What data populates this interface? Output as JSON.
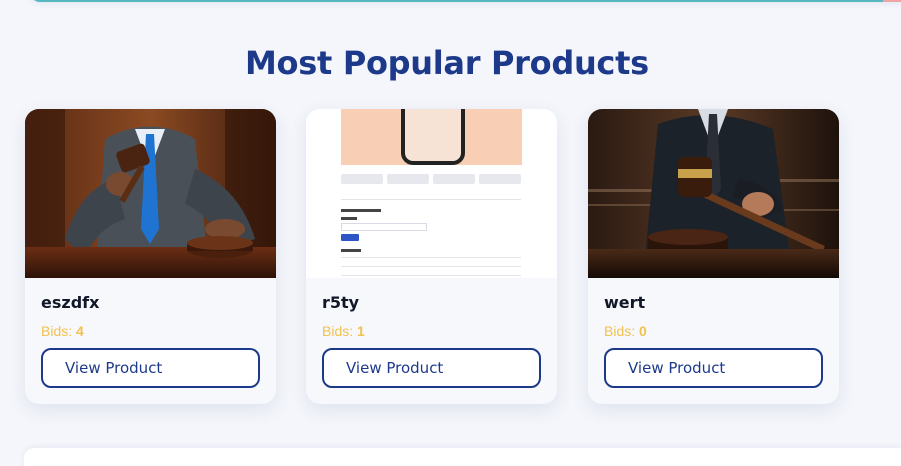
{
  "section": {
    "title": "Most Popular Products"
  },
  "products": [
    {
      "name": "eszdfx",
      "bids_label": "Bids:",
      "bids_count": "4",
      "button_label": "View Product",
      "image": "gavel-man-blue-tie"
    },
    {
      "name": "r5ty",
      "bids_label": "Bids:",
      "bids_count": "1",
      "button_label": "View Product",
      "image": "product-page-screenshot"
    },
    {
      "name": "wert",
      "bids_label": "Bids:",
      "bids_count": "0",
      "button_label": "View Product",
      "image": "gavel-man-dark-suit"
    }
  ],
  "colors": {
    "title": "#1d3a8a",
    "bids": "#f2c14e",
    "button_border": "#1d3a8a",
    "accent_strip": "#55b9be"
  }
}
